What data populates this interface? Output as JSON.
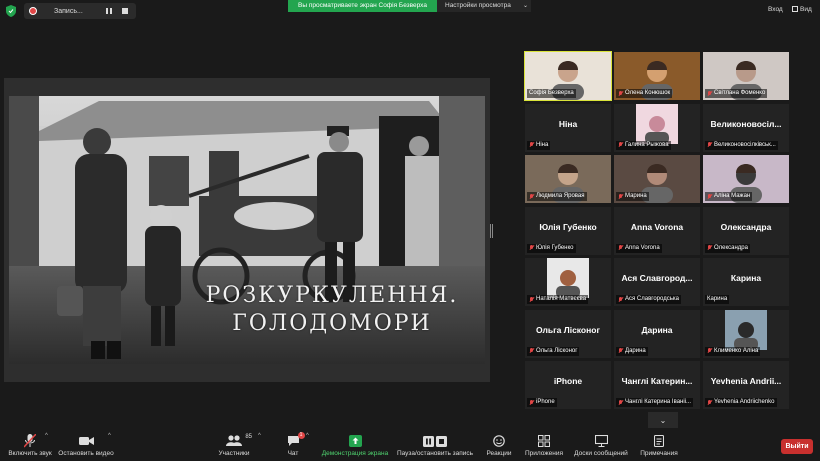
{
  "topbar": {
    "recording_label": "Запись...",
    "share_banner": "Вы просматриваете экран Софія Безверха",
    "view_settings": "Настройки просмотра",
    "enter_label": "Вход",
    "view_label": "Вид"
  },
  "slide": {
    "title_line1": "РОЗКУРКУЛЕННЯ.",
    "title_line2": "ГОЛОДОМОРИ"
  },
  "participants": [
    {
      "display": "",
      "tag": "Софія Безверха",
      "muted": false,
      "video": true
    },
    {
      "display": "",
      "tag": "Олена Конюшок",
      "muted": true,
      "video": true
    },
    {
      "display": "",
      "tag": "Світлана Фоменко",
      "muted": true,
      "video": true
    },
    {
      "display": "Ніна",
      "tag": "Ніна",
      "muted": true,
      "video": false
    },
    {
      "display": "",
      "tag": "Галина Рыжова",
      "muted": true,
      "video": true
    },
    {
      "display": "Великоновосіл...",
      "tag": "Великоновосілківськ...",
      "muted": true,
      "video": false
    },
    {
      "display": "",
      "tag": "Людмила Яровая",
      "muted": true,
      "video": true
    },
    {
      "display": "",
      "tag": "Марина",
      "muted": true,
      "video": true
    },
    {
      "display": "",
      "tag": "Аліна Мажан",
      "muted": true,
      "video": true
    },
    {
      "display": "Юлія Губенко",
      "tag": "Юлія Губенко",
      "muted": true,
      "video": false
    },
    {
      "display": "Anna Vorona",
      "tag": "Anna Vorona",
      "muted": true,
      "video": false
    },
    {
      "display": "Олександра",
      "tag": "Олександра",
      "muted": true,
      "video": false
    },
    {
      "display": "",
      "tag": "Наталія Матвєєва",
      "muted": true,
      "video": true
    },
    {
      "display": "Ася Славгород...",
      "tag": "Ася Славгородська",
      "muted": true,
      "video": false
    },
    {
      "display": "Карина",
      "tag": "Карина",
      "muted": false,
      "video": false
    },
    {
      "display": "Ольга Лісконог",
      "tag": "Ольга Лісконог",
      "muted": true,
      "video": false
    },
    {
      "display": "Дарина",
      "tag": "Дарина",
      "muted": true,
      "video": false
    },
    {
      "display": "",
      "tag": "Клименко Аліна",
      "muted": true,
      "video": true
    },
    {
      "display": "iPhone",
      "tag": "iPhone",
      "muted": true,
      "video": false
    },
    {
      "display": "Чанглі Катерин...",
      "tag": "Чанглі Катерина Іваніі...",
      "muted": true,
      "video": false
    },
    {
      "display": "Yevhenia Andrii...",
      "tag": "Yevhenia Andriichenko",
      "muted": true,
      "video": false
    }
  ],
  "toolbar": {
    "unmute": "Включить звук",
    "stop_video": "Остановить видео",
    "participants": "Участники",
    "participants_count": "85",
    "chat": "Чат",
    "chat_badge": "1",
    "share": "Демонстрация экрана",
    "pause_record": "Пауза/остановить запись",
    "reactions": "Реакции",
    "apps": "Приложения",
    "whiteboards": "Доски сообщений",
    "notes": "Примечания",
    "leave": "Выйти"
  },
  "colors": {
    "share_banner": "#23a54f",
    "speaking_outline": "#d9e33a",
    "leave": "#c8302e",
    "muted": "#e04646"
  }
}
